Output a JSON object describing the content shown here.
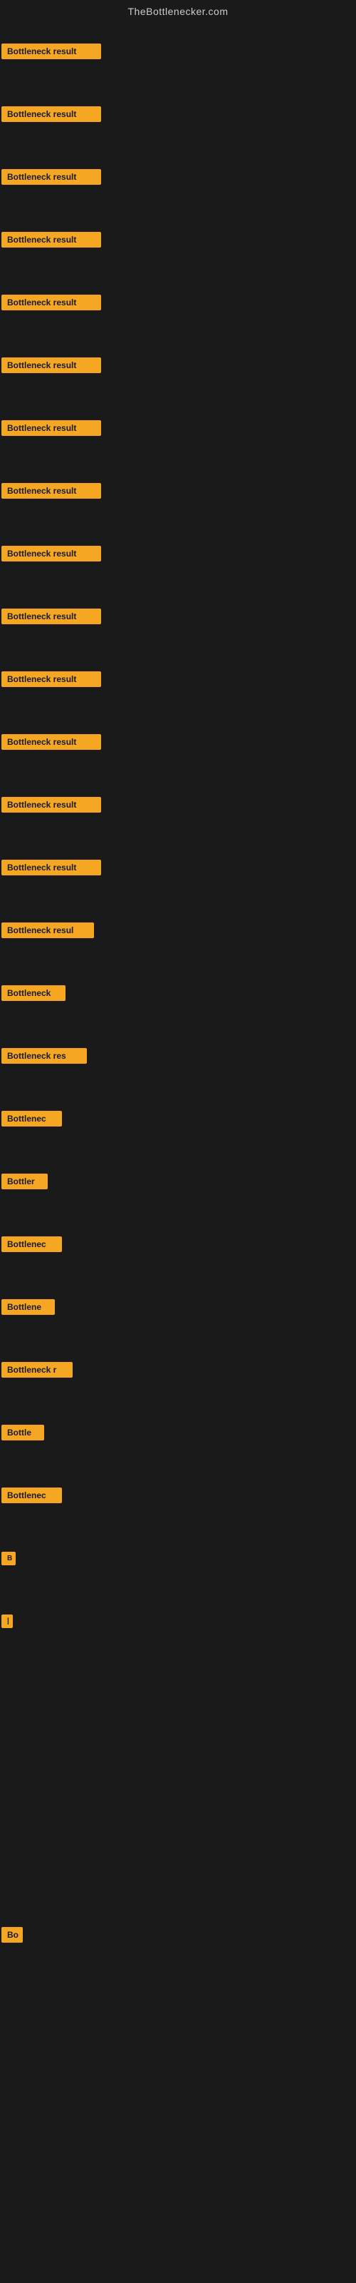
{
  "site": {
    "title": "TheBottlenecker.com"
  },
  "items": [
    {
      "id": 1,
      "label": "Bottleneck result",
      "class": "item-1"
    },
    {
      "id": 2,
      "label": "Bottleneck result",
      "class": "item-2"
    },
    {
      "id": 3,
      "label": "Bottleneck result",
      "class": "item-3"
    },
    {
      "id": 4,
      "label": "Bottleneck result",
      "class": "item-4"
    },
    {
      "id": 5,
      "label": "Bottleneck result",
      "class": "item-5"
    },
    {
      "id": 6,
      "label": "Bottleneck result",
      "class": "item-6"
    },
    {
      "id": 7,
      "label": "Bottleneck result",
      "class": "item-7"
    },
    {
      "id": 8,
      "label": "Bottleneck result",
      "class": "item-8"
    },
    {
      "id": 9,
      "label": "Bottleneck result",
      "class": "item-9"
    },
    {
      "id": 10,
      "label": "Bottleneck result",
      "class": "item-10"
    },
    {
      "id": 11,
      "label": "Bottleneck result",
      "class": "item-11"
    },
    {
      "id": 12,
      "label": "Bottleneck result",
      "class": "item-12"
    },
    {
      "id": 13,
      "label": "Bottleneck result",
      "class": "item-13"
    },
    {
      "id": 14,
      "label": "Bottleneck result",
      "class": "item-14"
    },
    {
      "id": 15,
      "label": "Bottleneck resul",
      "class": "item-15"
    },
    {
      "id": 16,
      "label": "Bottleneck",
      "class": "item-16"
    },
    {
      "id": 17,
      "label": "Bottleneck res",
      "class": "item-17"
    },
    {
      "id": 18,
      "label": "Bottlenec",
      "class": "item-18"
    },
    {
      "id": 19,
      "label": "Bottler",
      "class": "item-19"
    },
    {
      "id": 20,
      "label": "Bottlenec",
      "class": "item-20"
    },
    {
      "id": 21,
      "label": "Bottlene",
      "class": "item-21"
    },
    {
      "id": 22,
      "label": "Bottleneck r",
      "class": "item-22"
    },
    {
      "id": 23,
      "label": "Bottle",
      "class": "item-23"
    },
    {
      "id": 24,
      "label": "Bottlenec",
      "class": "item-24"
    },
    {
      "id": 25,
      "label": "B",
      "class": "item-25"
    },
    {
      "id": 26,
      "label": "|",
      "class": "item-26"
    }
  ],
  "extra_empty_rows": 4,
  "final_item": {
    "label": "Bo",
    "class": "final-item"
  },
  "final_extra_rows": 4
}
